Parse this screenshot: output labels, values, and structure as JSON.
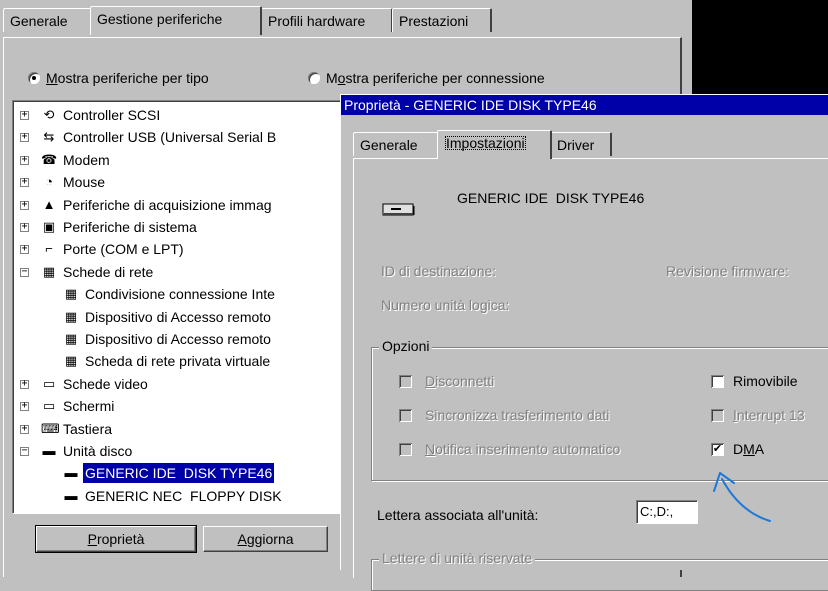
{
  "main_window": {
    "tabs": [
      {
        "label": "Generale"
      },
      {
        "label": "Gestione periferiche"
      },
      {
        "label": "Profili hardware"
      },
      {
        "label": "Prestazioni"
      }
    ],
    "radio_by_type": "Mostra periferiche per tipo",
    "radio_by_connection": "Mostra periferiche per connessione",
    "tree": [
      {
        "label": "Controller SCSI",
        "icon": "scsi-controller-icon",
        "glyph": "⟲",
        "expander": "+",
        "level": 0
      },
      {
        "label": "Controller USB (Universal Serial B",
        "icon": "usb-controller-icon",
        "glyph": "⇆",
        "expander": "+",
        "level": 0
      },
      {
        "label": "Modem",
        "icon": "modem-icon",
        "glyph": "☎",
        "expander": "+",
        "level": 0
      },
      {
        "label": "Mouse",
        "icon": "mouse-icon",
        "glyph": "◔",
        "expander": "+",
        "level": 0
      },
      {
        "label": "Periferiche di acquisizione immag",
        "icon": "imaging-device-icon",
        "glyph": "▲",
        "expander": "+",
        "level": 0
      },
      {
        "label": "Periferiche di sistema",
        "icon": "system-device-icon",
        "glyph": "▣",
        "expander": "+",
        "level": 0
      },
      {
        "label": "Porte (COM e LPT)",
        "icon": "port-icon",
        "glyph": "⌐",
        "expander": "+",
        "level": 0
      },
      {
        "label": "Schede di rete",
        "icon": "network-adapter-icon",
        "glyph": "▦",
        "expander": "−",
        "level": 0
      },
      {
        "label": "Condivisione connessione Inte",
        "icon": "network-adapter-icon",
        "glyph": "▦",
        "level": 1
      },
      {
        "label": "Dispositivo di Accesso remoto",
        "icon": "network-adapter-icon",
        "glyph": "▦",
        "level": 1
      },
      {
        "label": "Dispositivo di Accesso remoto",
        "icon": "network-adapter-icon",
        "glyph": "▦",
        "level": 1
      },
      {
        "label": "Scheda di rete privata virtuale",
        "icon": "network-adapter-icon",
        "glyph": "▦",
        "level": 1
      },
      {
        "label": "Schede video",
        "icon": "display-adapter-icon",
        "glyph": "▭",
        "expander": "+",
        "level": 0
      },
      {
        "label": "Schermi",
        "icon": "monitor-icon",
        "glyph": "▭",
        "expander": "+",
        "level": 0
      },
      {
        "label": "Tastiera",
        "icon": "keyboard-icon",
        "glyph": "⌨",
        "expander": "+",
        "level": 0
      },
      {
        "label": "Unità disco",
        "icon": "disk-drive-icon",
        "glyph": "▬",
        "expander": "−",
        "level": 0
      },
      {
        "label": "GENERIC IDE  DISK TYPE46",
        "icon": "disk-drive-icon",
        "glyph": "▬",
        "level": 1,
        "selected": true
      },
      {
        "label": "GENERIC NEC  FLOPPY DISK",
        "icon": "disk-drive-icon",
        "glyph": "▬",
        "level": 1
      }
    ],
    "buttons": {
      "properties": "Proprietà",
      "refresh": "Aggiorna"
    }
  },
  "dialog": {
    "title": "Proprietà - GENERIC IDE  DISK TYPE46",
    "tabs": [
      {
        "label": "Generale"
      },
      {
        "label": "Impostazioni"
      },
      {
        "label": "Driver"
      }
    ],
    "device_name": "GENERIC IDE  DISK TYPE46",
    "target_id_label": "ID di destinazione:",
    "firmware_label": "Revisione firmware:",
    "lun_label": "Numero unità logica:",
    "options_group": "Opzioni",
    "options": {
      "disconnect": {
        "label": "Disconnetti",
        "checked": false,
        "enabled": false
      },
      "sync": {
        "label": "Sincronizza trasferimento dati",
        "checked": false,
        "enabled": false
      },
      "autoinsert": {
        "label": "Notifica inserimento automatico",
        "checked": false,
        "enabled": false
      },
      "removable": {
        "label": "Rimovibile",
        "checked": false,
        "enabled": true
      },
      "int13": {
        "label": "Interrupt 13",
        "checked": false,
        "enabled": false
      },
      "dma": {
        "label": "DMA",
        "checked": true,
        "enabled": true,
        "check_glyph": "✔"
      }
    },
    "drive_letter_label": "Lettera associata all'unità:",
    "drive_letter_value": "C:,D:,",
    "reserved_group": "Lettere di unità riservate"
  },
  "colors": {
    "face": "#c0c0c0",
    "title_bar": "#0000a8",
    "selection": "#0000a8",
    "annotation": "#1e78d8",
    "black_area": "#000000"
  }
}
